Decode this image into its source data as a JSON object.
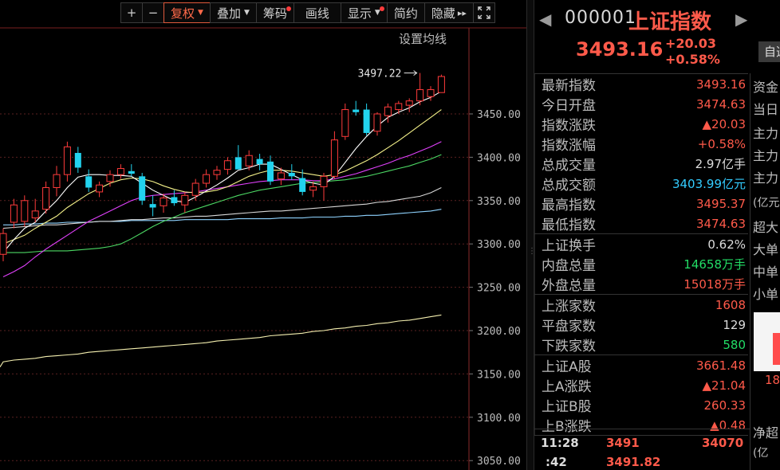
{
  "toolbar": {
    "plus": "+",
    "minus": "−",
    "buttons": [
      {
        "label": "复权",
        "caret": "▼",
        "active": true
      },
      {
        "label": "叠加",
        "caret": "▼"
      },
      {
        "label": "筹码",
        "dot": true
      },
      {
        "label": "画线"
      },
      {
        "label": "显示",
        "caret": "▼",
        "dot": true
      },
      {
        "label": "简约"
      },
      {
        "label": "隐藏",
        "suffix": "▸▸"
      }
    ],
    "fullscreen_icon": "fullscreen-icon"
  },
  "chart": {
    "ma_setting": "设置均线",
    "y_ticks": [
      "3450.00",
      "3400.00",
      "3350.00",
      "3300.00",
      "3250.00",
      "3200.00",
      "3150.00",
      "3100.00",
      "3050.00"
    ],
    "high_annotation": "3497.22",
    "colors": {
      "up": "#ff3b3b",
      "down": "#22d3ee",
      "ma5": "#ffffff",
      "ma10": "#f5f28a",
      "ma20": "#e040fb",
      "ma30": "#4cd964",
      "ma60": "#d8d8d8",
      "ma120": "#8fd3ff",
      "ma250": "#f5f0b0"
    }
  },
  "chart_data": {
    "type": "candlestick",
    "y_ticks": [
      3450,
      3400,
      3350,
      3300,
      3250,
      3200,
      3150,
      3100,
      3050
    ],
    "annotation": {
      "label": "3497.22",
      "value": 3497.22
    },
    "candles": [
      {
        "o": 3288,
        "h": 3318,
        "l": 3280,
        "c": 3312
      },
      {
        "o": 3325,
        "h": 3352,
        "l": 3318,
        "c": 3345
      },
      {
        "o": 3326,
        "h": 3356,
        "l": 3320,
        "c": 3350
      },
      {
        "o": 3330,
        "h": 3352,
        "l": 3325,
        "c": 3338
      },
      {
        "o": 3340,
        "h": 3372,
        "l": 3335,
        "c": 3365
      },
      {
        "o": 3365,
        "h": 3390,
        "l": 3355,
        "c": 3380
      },
      {
        "o": 3380,
        "h": 3418,
        "l": 3372,
        "c": 3412
      },
      {
        "o": 3405,
        "h": 3412,
        "l": 3382,
        "c": 3388
      },
      {
        "o": 3378,
        "h": 3386,
        "l": 3360,
        "c": 3365
      },
      {
        "o": 3360,
        "h": 3372,
        "l": 3354,
        "c": 3368
      },
      {
        "o": 3372,
        "h": 3385,
        "l": 3366,
        "c": 3380
      },
      {
        "o": 3380,
        "h": 3392,
        "l": 3375,
        "c": 3387
      },
      {
        "o": 3384,
        "h": 3392,
        "l": 3378,
        "c": 3381
      },
      {
        "o": 3378,
        "h": 3382,
        "l": 3345,
        "c": 3350
      },
      {
        "o": 3346,
        "h": 3356,
        "l": 3332,
        "c": 3342
      },
      {
        "o": 3344,
        "h": 3358,
        "l": 3336,
        "c": 3353
      },
      {
        "o": 3354,
        "h": 3362,
        "l": 3344,
        "c": 3347
      },
      {
        "o": 3345,
        "h": 3360,
        "l": 3336,
        "c": 3356
      },
      {
        "o": 3356,
        "h": 3375,
        "l": 3350,
        "c": 3370
      },
      {
        "o": 3370,
        "h": 3386,
        "l": 3365,
        "c": 3380
      },
      {
        "o": 3380,
        "h": 3390,
        "l": 3374,
        "c": 3385
      },
      {
        "o": 3386,
        "h": 3400,
        "l": 3380,
        "c": 3396
      },
      {
        "o": 3400,
        "h": 3414,
        "l": 3386,
        "c": 3386
      },
      {
        "o": 3390,
        "h": 3408,
        "l": 3385,
        "c": 3402
      },
      {
        "o": 3398,
        "h": 3404,
        "l": 3385,
        "c": 3392
      },
      {
        "o": 3395,
        "h": 3402,
        "l": 3368,
        "c": 3372
      },
      {
        "o": 3375,
        "h": 3388,
        "l": 3368,
        "c": 3382
      },
      {
        "o": 3382,
        "h": 3392,
        "l": 3374,
        "c": 3378
      },
      {
        "o": 3376,
        "h": 3386,
        "l": 3356,
        "c": 3360
      },
      {
        "o": 3362,
        "h": 3372,
        "l": 3354,
        "c": 3366
      },
      {
        "o": 3366,
        "h": 3382,
        "l": 3350,
        "c": 3378
      },
      {
        "o": 3378,
        "h": 3430,
        "l": 3375,
        "c": 3420
      },
      {
        "o": 3424,
        "h": 3462,
        "l": 3420,
        "c": 3455
      },
      {
        "o": 3455,
        "h": 3465,
        "l": 3448,
        "c": 3452
      },
      {
        "o": 3455,
        "h": 3462,
        "l": 3425,
        "c": 3428
      },
      {
        "o": 3430,
        "h": 3452,
        "l": 3425,
        "c": 3450
      },
      {
        "o": 3448,
        "h": 3462,
        "l": 3440,
        "c": 3458
      },
      {
        "o": 3455,
        "h": 3465,
        "l": 3450,
        "c": 3462
      },
      {
        "o": 3460,
        "h": 3468,
        "l": 3452,
        "c": 3465
      },
      {
        "o": 3465,
        "h": 3497.22,
        "l": 3460,
        "c": 3478
      },
      {
        "o": 3470,
        "h": 3482,
        "l": 3465,
        "c": 3478
      },
      {
        "o": 3474.63,
        "h": 3495.37,
        "l": 3474.63,
        "c": 3493.16
      }
    ],
    "ma5": [
      3290,
      3305,
      3318,
      3325,
      3338,
      3350,
      3365,
      3377,
      3380,
      3380,
      3379,
      3379,
      3378,
      3370,
      3362,
      3356,
      3350,
      3348,
      3354,
      3361,
      3368,
      3376,
      3385,
      3388,
      3392,
      3392,
      3386,
      3380,
      3374,
      3370,
      3368,
      3378,
      3394,
      3410,
      3424,
      3436,
      3446,
      3452,
      3457,
      3464,
      3469,
      3476
    ],
    "ma10": [
      3300,
      3305,
      3310,
      3318,
      3325,
      3332,
      3342,
      3350,
      3358,
      3364,
      3370,
      3374,
      3376,
      3375,
      3372,
      3367,
      3363,
      3360,
      3359,
      3360,
      3362,
      3366,
      3372,
      3378,
      3382,
      3385,
      3385,
      3384,
      3382,
      3380,
      3378,
      3380,
      3384,
      3390,
      3396,
      3403,
      3411,
      3419,
      3428,
      3437,
      3446,
      3455
    ],
    "ma20": [
      3262,
      3268,
      3275,
      3285,
      3294,
      3302,
      3310,
      3318,
      3326,
      3332,
      3338,
      3344,
      3350,
      3354,
      3356,
      3357,
      3358,
      3359,
      3360,
      3362,
      3364,
      3366,
      3368,
      3370,
      3372,
      3373,
      3374,
      3374,
      3374,
      3373,
      3373,
      3375,
      3378,
      3381,
      3385,
      3389,
      3393,
      3398,
      3402,
      3407,
      3412,
      3418
    ],
    "ma30": [
      3290,
      3290,
      3290,
      3291,
      3292,
      3292,
      3292,
      3293,
      3294,
      3295,
      3297,
      3300,
      3306,
      3313,
      3320,
      3326,
      3331,
      3336,
      3340,
      3344,
      3348,
      3352,
      3356,
      3359,
      3362,
      3364,
      3366,
      3368,
      3370,
      3371,
      3372,
      3373,
      3374,
      3376,
      3378,
      3381,
      3384,
      3387,
      3390,
      3394,
      3398,
      3403
    ],
    "ma60": [
      3318,
      3319,
      3320,
      3321,
      3322,
      3322,
      3323,
      3324,
      3325,
      3326,
      3326,
      3327,
      3328,
      3328,
      3329,
      3330,
      3330,
      3331,
      3332,
      3332,
      3333,
      3334,
      3335,
      3336,
      3337,
      3338,
      3338,
      3339,
      3340,
      3341,
      3342,
      3343,
      3344,
      3345,
      3346,
      3348,
      3349,
      3351,
      3353,
      3355,
      3359,
      3365
    ],
    "ma120": [
      3322,
      3322,
      3323,
      3323,
      3324,
      3324,
      3325,
      3325,
      3325,
      3326,
      3326,
      3326,
      3327,
      3327,
      3327,
      3327,
      3327,
      3328,
      3328,
      3328,
      3328,
      3328,
      3329,
      3329,
      3329,
      3329,
      3330,
      3330,
      3330,
      3331,
      3331,
      3331,
      3332,
      3332,
      3333,
      3333,
      3334,
      3335,
      3336,
      3337,
      3338,
      3340
    ],
    "ma250": [
      3164,
      3166,
      3167,
      3168,
      3170,
      3171,
      3172,
      3173,
      3175,
      3176,
      3177,
      3178,
      3179,
      3180,
      3181,
      3182,
      3183,
      3184,
      3185,
      3186,
      3188,
      3189,
      3190,
      3191,
      3192,
      3194,
      3195,
      3196,
      3197,
      3199,
      3200,
      3202,
      3203,
      3205,
      3206,
      3208,
      3209,
      3211,
      3212,
      3214,
      3216,
      3218
    ]
  },
  "quote": {
    "code": "000001",
    "name": "上证指数",
    "price": "3493.16",
    "change": "+20.03",
    "change_pct": "+0.58%",
    "side_button": "自选",
    "groups": [
      [
        {
          "label": "最新指数",
          "value": "3493.16",
          "cls": "up"
        },
        {
          "label": "今日开盘",
          "value": "3474.63",
          "cls": "up"
        },
        {
          "label": "指数涨跌",
          "value": "▲20.03",
          "cls": "up"
        },
        {
          "label": "指数涨幅",
          "value": "+0.58%",
          "cls": "up"
        },
        {
          "label": "总成交量",
          "value": "2.97亿手",
          "cls": "wh"
        },
        {
          "label": "总成交额",
          "value": "3403.99亿元",
          "cls": "cy"
        },
        {
          "label": "最高指数",
          "value": "3495.37",
          "cls": "up"
        },
        {
          "label": "最低指数",
          "value": "3474.63",
          "cls": "up"
        }
      ],
      [
        {
          "label": "上证换手",
          "value": "0.62%",
          "cls": "wh"
        },
        {
          "label": "内盘总量",
          "value": "14658万手",
          "cls": "down"
        },
        {
          "label": "外盘总量",
          "value": "15018万手",
          "cls": "up"
        }
      ],
      [
        {
          "label": "上涨家数",
          "value": "1608",
          "cls": "up"
        },
        {
          "label": "平盘家数",
          "value": "129",
          "cls": "wh"
        },
        {
          "label": "下跌家数",
          "value": "580",
          "cls": "down"
        }
      ],
      [
        {
          "label": "上证A股",
          "value": "3661.48",
          "cls": "up"
        },
        {
          "label": "上A涨跌",
          "value": "▲21.04",
          "cls": "up"
        },
        {
          "label": "上证B股",
          "value": "260.33",
          "cls": "up"
        },
        {
          "label": "上B涨跌",
          "value": "▲0.48",
          "cls": "up"
        }
      ]
    ],
    "ticks": [
      {
        "time": "11:28",
        "price": "3491",
        "vol": "34070"
      },
      {
        "time": ":42",
        "price": "3491.82",
        "vol": ""
      }
    ]
  },
  "right_strip": {
    "tabs": [
      "资金",
      "当日"
    ],
    "labels": [
      "主力",
      "主力",
      "主力",
      "(亿元",
      "超大",
      "大单",
      "中单",
      "小单",
      "18",
      "净超",
      "(亿"
    ]
  }
}
